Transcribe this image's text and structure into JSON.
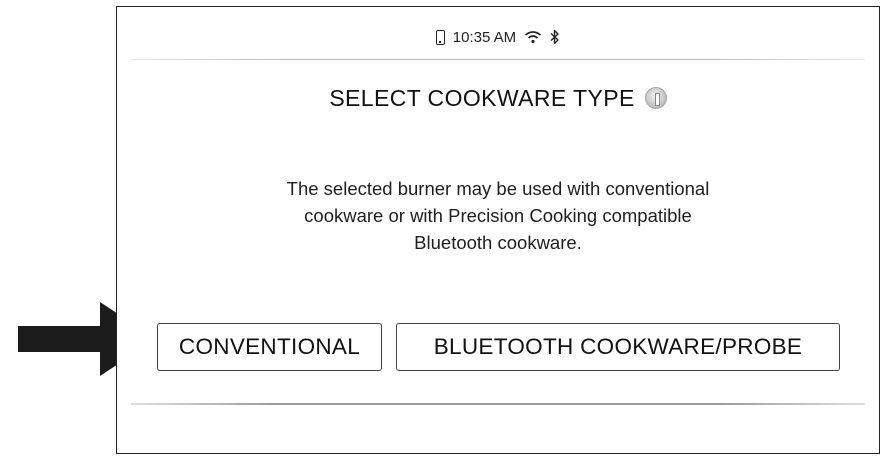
{
  "status_bar": {
    "time": "10:35 AM",
    "icons": [
      "phone-icon",
      "wifi-icon",
      "bluetooth-icon"
    ]
  },
  "dialog": {
    "title": "SELECT COOKWARE TYPE",
    "title_icon": "info-icon",
    "message_lines": [
      "The selected burner may be used with conventional",
      "cookware or with Precision Cooking compatible",
      "Bluetooth cookware."
    ]
  },
  "buttons": {
    "conventional": "CONVENTIONAL",
    "bluetooth": "BLUETOOTH COOKWARE/PROBE"
  },
  "callout": {
    "icon": "pointer-arrow-icon",
    "target": "conventional-button"
  }
}
